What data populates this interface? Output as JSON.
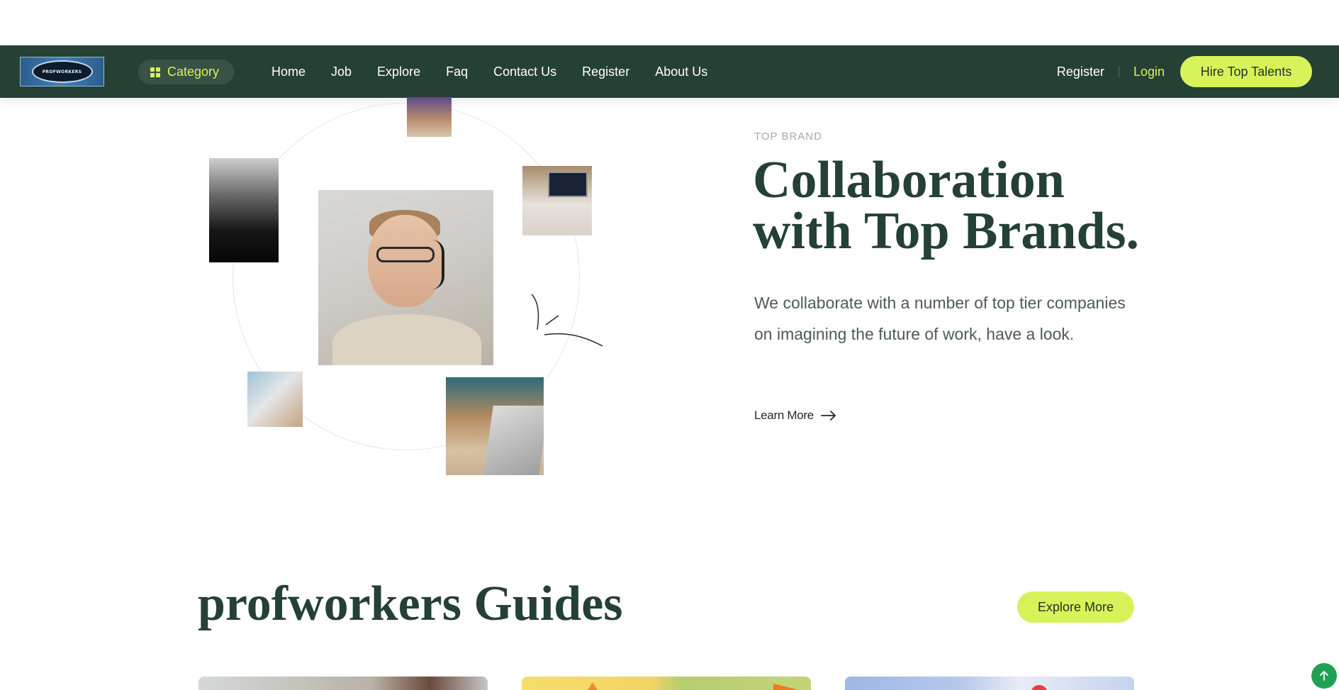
{
  "brand": {
    "logo_text": "PROFWORKERS"
  },
  "nav": {
    "category_label": "Category",
    "links": [
      "Home",
      "Job",
      "Explore",
      "Faq",
      "Contact Us",
      "Register",
      "About Us"
    ],
    "register_label": "Register",
    "login_label": "Login",
    "hire_label": "Hire Top Talents"
  },
  "hero": {
    "eyebrow": "TOP BRAND",
    "title": "Collaboration with Top Brands.",
    "description": "We collaborate with a number of top tier companies on imagining the future of work, have a look.",
    "learn_more": "Learn More"
  },
  "guides": {
    "title": "profworkers Guides",
    "explore_label": "Explore More"
  },
  "colors": {
    "primary_dark": "#254034",
    "accent_lime": "#d8f25a",
    "scroll_top_green": "#1fa054"
  },
  "icons": {
    "category": "grid-icon",
    "learn_more": "arrow-right-icon",
    "scroll_top": "arrow-up-icon"
  }
}
